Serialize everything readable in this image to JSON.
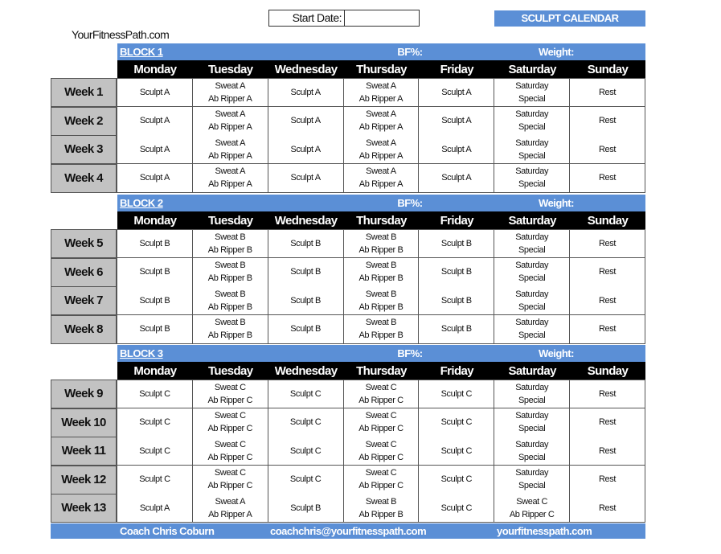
{
  "header": {
    "start_date_label": "Start Date:",
    "start_date_value": "",
    "title": "SCULPT CALENDAR",
    "site_name": "YourFitnessPath.com"
  },
  "days": [
    "Monday",
    "Tuesday",
    "Wednesday",
    "Thursday",
    "Friday",
    "Saturday",
    "Sunday"
  ],
  "blocks": [
    {
      "name": "BLOCK 1",
      "bf_label": "BF%:",
      "weight_label": "Weight:",
      "weeks": [
        {
          "label": "Week 1",
          "cells": [
            [
              "Sculpt A"
            ],
            [
              "Sweat A",
              "Ab Ripper A"
            ],
            [
              "Sculpt A"
            ],
            [
              "Sweat A",
              "Ab Ripper A"
            ],
            [
              "Sculpt A"
            ],
            [
              "Saturday",
              "Special"
            ],
            [
              "Rest"
            ]
          ]
        },
        {
          "label": "Week 2",
          "cells": [
            [
              "Sculpt A"
            ],
            [
              "Sweat A",
              "Ab Ripper A"
            ],
            [
              "Sculpt A"
            ],
            [
              "Sweat A",
              "Ab Ripper A"
            ],
            [
              "Sculpt A"
            ],
            [
              "Saturday",
              "Special"
            ],
            [
              "Rest"
            ]
          ]
        },
        {
          "label": "Week 3",
          "cells": [
            [
              "Sculpt A"
            ],
            [
              "Sweat A",
              "Ab Ripper A"
            ],
            [
              "Sculpt A"
            ],
            [
              "Sweat A",
              "Ab Ripper A"
            ],
            [
              "Sculpt A"
            ],
            [
              "Saturday",
              "Special"
            ],
            [
              "Rest"
            ]
          ]
        },
        {
          "label": "Week 4",
          "cells": [
            [
              "Sculpt A"
            ],
            [
              "Sweat A",
              "Ab Ripper A"
            ],
            [
              "Sculpt A"
            ],
            [
              "Sweat A",
              "Ab Ripper A"
            ],
            [
              "Sculpt A"
            ],
            [
              "Saturday",
              "Special"
            ],
            [
              "Rest"
            ]
          ]
        }
      ]
    },
    {
      "name": "BLOCK 2",
      "bf_label": "BF%:",
      "weight_label": "Weight:",
      "weeks": [
        {
          "label": "Week 5",
          "cells": [
            [
              "Sculpt B"
            ],
            [
              "Sweat B",
              "Ab Ripper B"
            ],
            [
              "Sculpt B"
            ],
            [
              "Sweat B",
              "Ab Ripper B"
            ],
            [
              "Sculpt B"
            ],
            [
              "Saturday",
              "Special"
            ],
            [
              "Rest"
            ]
          ]
        },
        {
          "label": "Week 6",
          "cells": [
            [
              "Sculpt B"
            ],
            [
              "Sweat B",
              "Ab Ripper B"
            ],
            [
              "Sculpt B"
            ],
            [
              "Sweat B",
              "Ab Ripper B"
            ],
            [
              "Sculpt B"
            ],
            [
              "Saturday",
              "Special"
            ],
            [
              "Rest"
            ]
          ]
        },
        {
          "label": "Week 7",
          "cells": [
            [
              "Sculpt B"
            ],
            [
              "Sweat B",
              "Ab Ripper B"
            ],
            [
              "Sculpt B"
            ],
            [
              "Sweat B",
              "Ab Ripper B"
            ],
            [
              "Sculpt B"
            ],
            [
              "Saturday",
              "Special"
            ],
            [
              "Rest"
            ]
          ]
        },
        {
          "label": "Week 8",
          "cells": [
            [
              "Sculpt B"
            ],
            [
              "Sweat B",
              "Ab Ripper B"
            ],
            [
              "Sculpt B"
            ],
            [
              "Sweat B",
              "Ab Ripper B"
            ],
            [
              "Sculpt B"
            ],
            [
              "Saturday",
              "Special"
            ],
            [
              "Rest"
            ]
          ]
        }
      ]
    },
    {
      "name": "BLOCK 3",
      "bf_label": "BF%:",
      "weight_label": "Weight:",
      "weeks": [
        {
          "label": "Week 9",
          "cells": [
            [
              "Sculpt C"
            ],
            [
              "Sweat C",
              "Ab Ripper C"
            ],
            [
              "Sculpt C"
            ],
            [
              "Sweat C",
              "Ab Ripper C"
            ],
            [
              "Sculpt C"
            ],
            [
              "Saturday",
              "Special"
            ],
            [
              "Rest"
            ]
          ]
        },
        {
          "label": "Week 10",
          "cells": [
            [
              "Sculpt C"
            ],
            [
              "Sweat C",
              "Ab Ripper C"
            ],
            [
              "Sculpt C"
            ],
            [
              "Sweat C",
              "Ab Ripper C"
            ],
            [
              "Sculpt C"
            ],
            [
              "Saturday",
              "Special"
            ],
            [
              "Rest"
            ]
          ]
        },
        {
          "label": "Week 11",
          "cells": [
            [
              "Sculpt C"
            ],
            [
              "Sweat C",
              "Ab Ripper C"
            ],
            [
              "Sculpt C"
            ],
            [
              "Sweat C",
              "Ab Ripper C"
            ],
            [
              "Sculpt C"
            ],
            [
              "Saturday",
              "Special"
            ],
            [
              "Rest"
            ]
          ]
        },
        {
          "label": "Week 12",
          "cells": [
            [
              "Sculpt C"
            ],
            [
              "Sweat C",
              "Ab Ripper C"
            ],
            [
              "Sculpt C"
            ],
            [
              "Sweat C",
              "Ab Ripper C"
            ],
            [
              "Sculpt C"
            ],
            [
              "Saturday",
              "Special"
            ],
            [
              "Rest"
            ]
          ]
        },
        {
          "label": "Week 13",
          "cells": [
            [
              "Sculpt A"
            ],
            [
              "Sweat A",
              "Ab Ripper A"
            ],
            [
              "Sculpt B"
            ],
            [
              "Sweat B",
              "Ab Ripper B"
            ],
            [
              "Sculpt C"
            ],
            [
              "Sweat C",
              "Ab Ripper C"
            ],
            [
              "Rest"
            ]
          ]
        }
      ]
    }
  ],
  "footer": {
    "coach": "Coach Chris Coburn",
    "email": "coachchris@yourfitnesspath.com",
    "site": "yourfitnesspath.com"
  },
  "colors": {
    "accent": "#5b8fd6",
    "header_bg": "#000000",
    "week_label_bg": "#c2c2c2"
  }
}
